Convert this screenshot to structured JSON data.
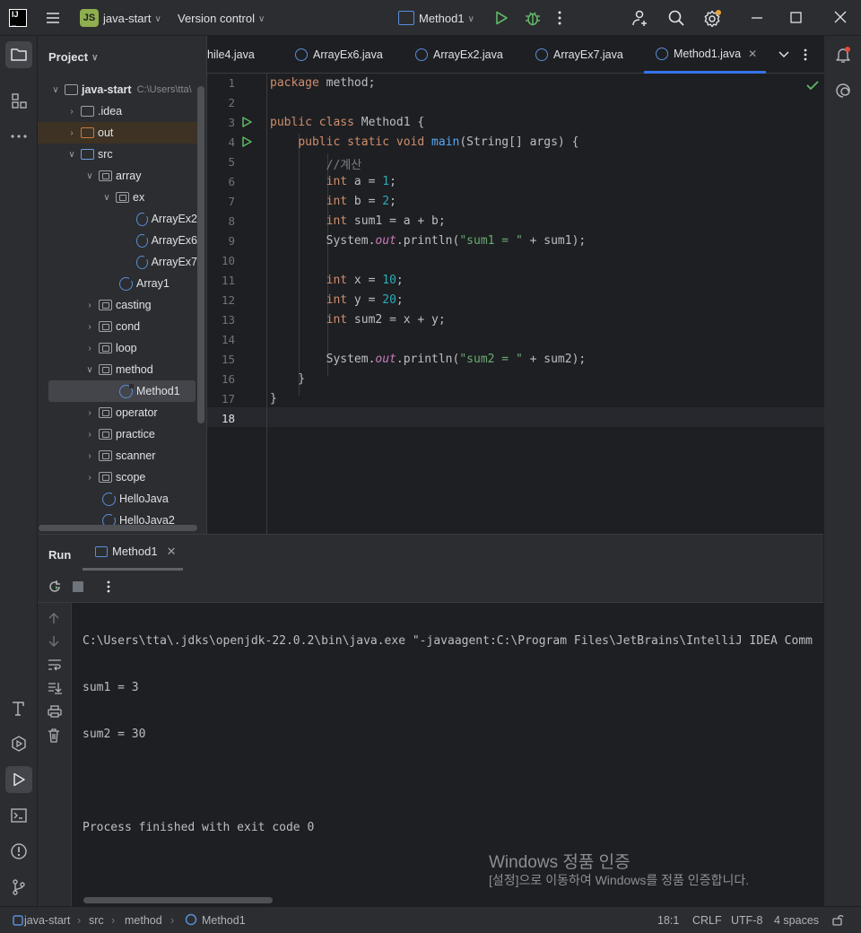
{
  "titlebar": {
    "project_badge": "JS",
    "project_name": "java-start",
    "version_control": "Version control",
    "run_config": "Method1"
  },
  "project_panel": {
    "title": "Project",
    "root": {
      "label": "java-start",
      "hint": "C:\\Users\\tta\\"
    },
    "items": [
      {
        "label": ".idea"
      },
      {
        "label": "out"
      },
      {
        "label": "src"
      },
      {
        "label": "array"
      },
      {
        "label": "ex"
      },
      {
        "label": "ArrayEx2"
      },
      {
        "label": "ArrayEx6"
      },
      {
        "label": "ArrayEx7"
      },
      {
        "label": "Array1"
      },
      {
        "label": "casting"
      },
      {
        "label": "cond"
      },
      {
        "label": "loop"
      },
      {
        "label": "method"
      },
      {
        "label": "Method1"
      },
      {
        "label": "operator"
      },
      {
        "label": "practice"
      },
      {
        "label": "scanner"
      },
      {
        "label": "scope"
      },
      {
        "label": "HelloJava"
      },
      {
        "label": "HelloJava2"
      }
    ]
  },
  "editor": {
    "tabs": [
      "hile4.java",
      "ArrayEx6.java",
      "ArrayEx2.java",
      "ArrayEx7.java",
      "Method1.java"
    ],
    "active_tab": "Method1.java",
    "line_numbers": [
      "1",
      "2",
      "3",
      "4",
      "5",
      "6",
      "7",
      "8",
      "9",
      "10",
      "11",
      "12",
      "13",
      "14",
      "15",
      "16",
      "17",
      "18"
    ]
  },
  "run_panel": {
    "title": "Run",
    "tab": "Method1",
    "console": [
      "C:\\Users\\tta\\.jdks\\openjdk-22.0.2\\bin\\java.exe \"-javaagent:C:\\Program Files\\JetBrains\\IntelliJ IDEA Comm",
      "sum1 = 3",
      "sum2 = 30",
      "",
      "Process finished with exit code 0"
    ]
  },
  "watermark": {
    "line1": "Windows 정품 인증",
    "line2": "[설정]으로 이동하여 Windows를 정품 인증합니다."
  },
  "statusbar": {
    "crumbs": [
      "java-start",
      "src",
      "method",
      "Method1"
    ],
    "position": "18:1",
    "line_sep": "CRLF",
    "encoding": "UTF-8",
    "indent": "4 spaces"
  }
}
